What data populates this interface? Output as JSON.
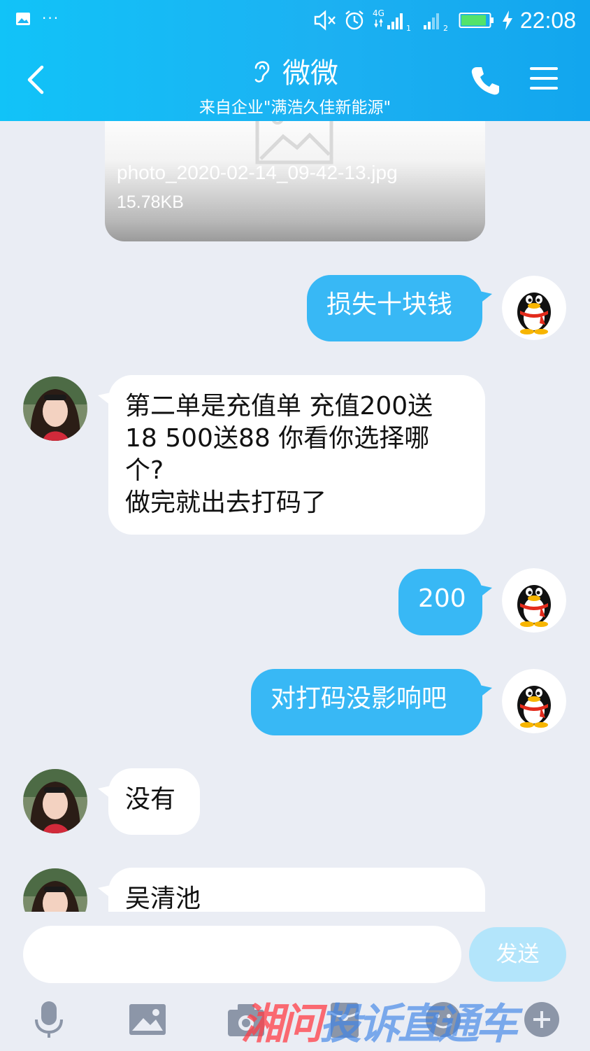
{
  "status_bar": {
    "time": "22:08",
    "network": "4G",
    "sim1": "1",
    "sim2": "2",
    "battery_level": 0.9
  },
  "header": {
    "title": "微微",
    "subtitle": "来自企业\"满浩久佳新能源\""
  },
  "file_card": {
    "name": "photo_2020-02-14_09-42-13.jpg",
    "size": "15.78KB"
  },
  "messages": [
    {
      "direction": "out",
      "text": "损失十块钱"
    },
    {
      "direction": "in",
      "lines": [
        "第二单是充值单  充值200送",
        "18  500送88  你看你选择哪",
        "个?",
        "做完就出去打码了"
      ]
    },
    {
      "direction": "out",
      "text": "200"
    },
    {
      "direction": "out",
      "text": "对打码没影响吧"
    },
    {
      "direction": "in",
      "text": "没有"
    },
    {
      "direction": "in",
      "text": "吴清池"
    }
  ],
  "composer": {
    "input_value": "",
    "send_label": "发送"
  },
  "toolbar_icons": [
    "microphone-icon",
    "image-icon",
    "camera-icon",
    "red-packet-icon",
    "emoji-icon",
    "plus-icon"
  ],
  "watermark": {
    "part1": "湘问",
    "part2": "投诉直通车"
  },
  "colors": {
    "header": "#1cb1f2",
    "bubble_out": "#38b8f5",
    "bubble_in": "#ffffff",
    "background": "#eaedf4",
    "send_button": "#b3e5fb"
  }
}
